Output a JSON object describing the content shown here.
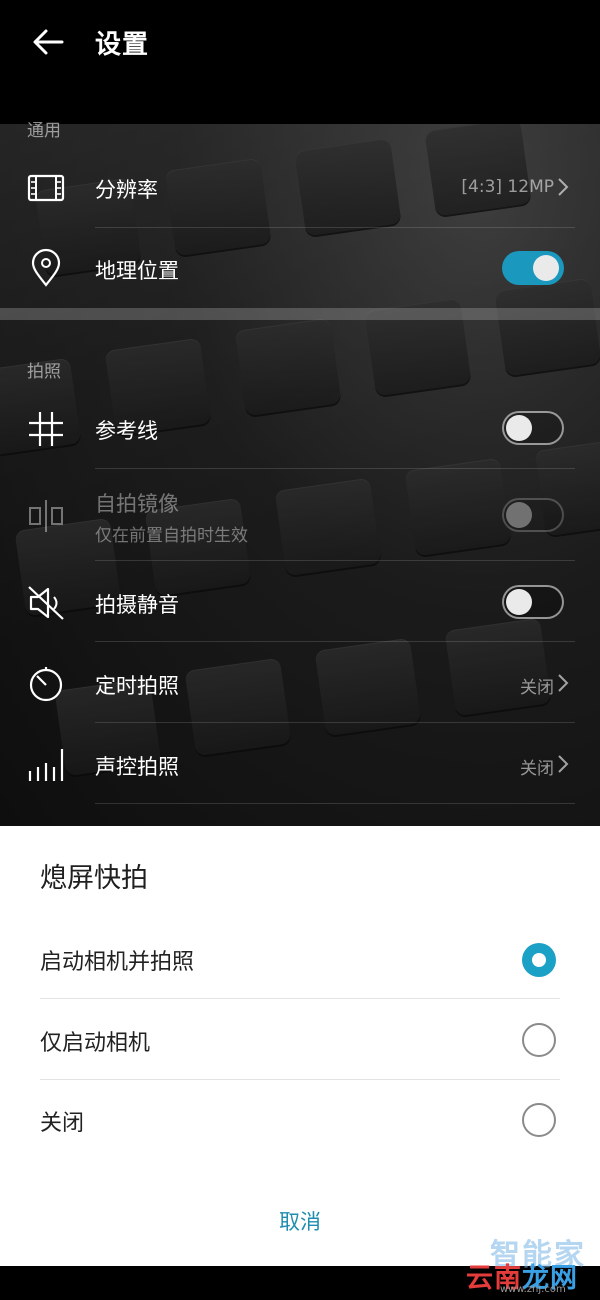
{
  "header": {
    "title": "设置"
  },
  "sections": {
    "general": {
      "title": "通用",
      "resolution": {
        "label": "分辨率",
        "value": "[4:3] 12MP"
      },
      "location": {
        "label": "地理位置",
        "toggle": "on"
      }
    },
    "photo": {
      "title": "拍照",
      "grid": {
        "label": "参考线",
        "toggle": "off"
      },
      "mirror": {
        "label": "自拍镜像",
        "sublabel": "仅在前置自拍时生效",
        "toggle": "off",
        "enabled": false
      },
      "mute": {
        "label": "拍摄静音",
        "toggle": "off"
      },
      "timer": {
        "label": "定时拍照",
        "value": "关闭"
      },
      "voice": {
        "label": "声控拍照",
        "value": "关闭"
      }
    }
  },
  "sheet": {
    "title": "熄屏快拍",
    "options": [
      {
        "label": "启动相机并拍照",
        "selected": true
      },
      {
        "label": "仅启动相机",
        "selected": false
      },
      {
        "label": "关闭",
        "selected": false
      }
    ],
    "cancel": "取消"
  },
  "watermark": {
    "line1": "智能家",
    "line2a": "云南",
    "line2b": "龙网",
    "line3": "www.znj.com"
  },
  "colors": {
    "accent": "#1b98bd",
    "cancel": "#1f8cb0"
  },
  "icons": [
    "back-arrow-icon",
    "resolution-icon",
    "location-pin-icon",
    "grid-icon",
    "mirror-icon",
    "mute-icon",
    "timer-icon",
    "voice-icon",
    "chevron-right-icon"
  ]
}
